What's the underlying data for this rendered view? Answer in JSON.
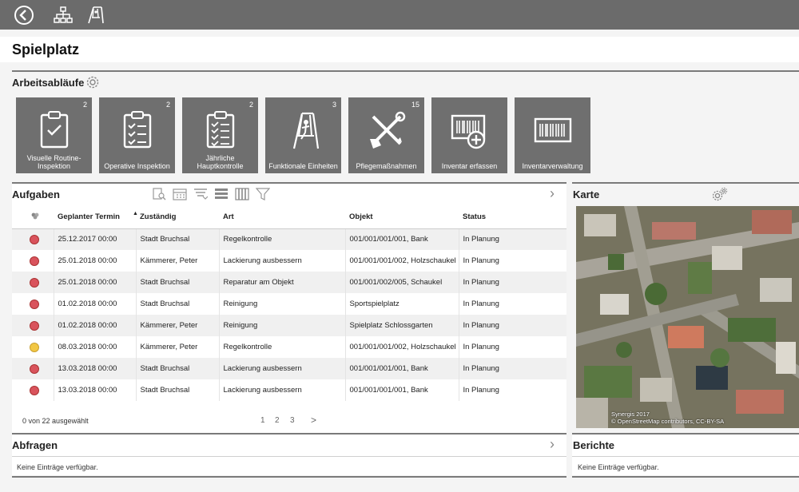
{
  "topbar": {
    "back_icon": "back-circle-icon",
    "hierarchy_icon": "hierarchy-icon",
    "playground_icon": "swing-icon"
  },
  "page": {
    "title": "Spielplatz"
  },
  "workflows": {
    "heading": "Arbeitsabläufe",
    "settings_icon": "gear-icon",
    "tiles": [
      {
        "label": "Visuelle Routine-Inspektion",
        "count": "2",
        "icon": "clipboard-icon"
      },
      {
        "label": "Operative Inspektion",
        "count": "2",
        "icon": "checklist-icon"
      },
      {
        "label": "Jährliche Hauptkontrolle",
        "count": "2",
        "icon": "checklist-icon"
      },
      {
        "label": "Funktionale Einheiten",
        "count": "3",
        "icon": "swing-icon"
      },
      {
        "label": "Pflegemaßnahmen",
        "count": "15",
        "icon": "tools-icon"
      },
      {
        "label": "Inventar erfassen",
        "count": "",
        "icon": "barcode-add-icon"
      },
      {
        "label": "Inventarverwaltung",
        "count": "",
        "icon": "barcode-icon"
      }
    ]
  },
  "tasks": {
    "heading": "Aufgaben",
    "columns": [
      "",
      "Geplanter Termin",
      "Zuständig",
      "Art",
      "Objekt",
      "Status"
    ],
    "rows": [
      {
        "status_color": "red",
        "date": "25.12.2017 00:00",
        "owner": "Stadt Bruchsal",
        "type": "Regelkontrolle",
        "object": "001/001/001/001, Bank",
        "status": "In Planung"
      },
      {
        "status_color": "red",
        "date": "25.01.2018 00:00",
        "owner": "Kämmerer, Peter",
        "type": "Lackierung ausbessern",
        "object": "001/001/001/002, Holzschaukel",
        "status": "In Planung"
      },
      {
        "status_color": "red",
        "date": "25.01.2018 00:00",
        "owner": "Stadt Bruchsal",
        "type": "Reparatur am Objekt",
        "object": "001/001/002/005, Schaukel",
        "status": "In Planung"
      },
      {
        "status_color": "red",
        "date": "01.02.2018 00:00",
        "owner": "Stadt Bruchsal",
        "type": "Reinigung",
        "object": "Sportspielplatz",
        "status": "In Planung"
      },
      {
        "status_color": "red",
        "date": "01.02.2018 00:00",
        "owner": "Kämmerer, Peter",
        "type": "Reinigung",
        "object": "Spielplatz Schlossgarten",
        "status": "In Planung"
      },
      {
        "status_color": "yellow",
        "date": "08.03.2018 00:00",
        "owner": "Kämmerer, Peter",
        "type": "Regelkontrolle",
        "object": "001/001/001/002, Holzschaukel",
        "status": "In Planung"
      },
      {
        "status_color": "red",
        "date": "13.03.2018 00:00",
        "owner": "Stadt Bruchsal",
        "type": "Lackierung ausbessern",
        "object": "001/001/001/001, Bank",
        "status": "In Planung"
      },
      {
        "status_color": "red",
        "date": "13.03.2018 00:00",
        "owner": "Stadt Bruchsal",
        "type": "Lackierung ausbessern",
        "object": "001/001/001/001, Bank",
        "status": "In Planung"
      }
    ],
    "selection_count": "0",
    "selection_text": "von 22 ausgewählt",
    "pages": [
      "1",
      "2",
      "3"
    ],
    "next_label": ">"
  },
  "map": {
    "heading": "Karte",
    "credit_line1": "Synergis 2017",
    "credit_line2": "© OpenStreetMap contributors, CC-BY-SA"
  },
  "queries": {
    "heading": "Abfragen",
    "empty": "Keine Einträge verfügbar."
  },
  "reports": {
    "heading": "Berichte",
    "empty": "Keine Einträge verfügbar."
  }
}
